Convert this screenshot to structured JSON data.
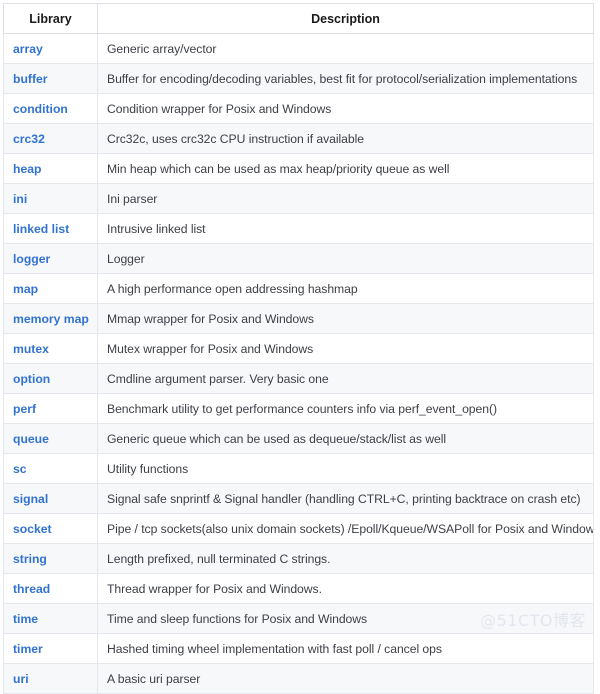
{
  "table": {
    "headers": {
      "library": "Library",
      "description": "Description"
    },
    "rows": [
      {
        "library": "array",
        "description": "Generic array/vector"
      },
      {
        "library": "buffer",
        "description": "Buffer for encoding/decoding variables, best fit for protocol/serialization implementations"
      },
      {
        "library": "condition",
        "description": "Condition wrapper for Posix and Windows"
      },
      {
        "library": "crc32",
        "description": "Crc32c, uses crc32c CPU instruction if available"
      },
      {
        "library": "heap",
        "description": "Min heap which can be used as max heap/priority queue as well"
      },
      {
        "library": "ini",
        "description": "Ini parser"
      },
      {
        "library": "linked list",
        "description": "Intrusive linked list"
      },
      {
        "library": "logger",
        "description": "Logger"
      },
      {
        "library": "map",
        "description": "A high performance open addressing hashmap"
      },
      {
        "library": "memory map",
        "description": "Mmap wrapper for Posix and Windows"
      },
      {
        "library": "mutex",
        "description": "Mutex wrapper for Posix and Windows"
      },
      {
        "library": "option",
        "description": "Cmdline argument parser. Very basic one"
      },
      {
        "library": "perf",
        "description": "Benchmark utility to get performance counters info via perf_event_open()"
      },
      {
        "library": "queue",
        "description": "Generic queue which can be used as dequeue/stack/list as well"
      },
      {
        "library": "sc",
        "description": "Utility functions"
      },
      {
        "library": "signal",
        "description": "Signal safe snprintf & Signal handler (handling CTRL+C, printing backtrace on crash etc)"
      },
      {
        "library": "socket",
        "description": "Pipe / tcp sockets(also unix domain sockets) /Epoll/Kqueue/WSAPoll for Posix and Windows"
      },
      {
        "library": "string",
        "description": "Length prefixed, null terminated C strings."
      },
      {
        "library": "thread",
        "description": "Thread wrapper for Posix and Windows."
      },
      {
        "library": "time",
        "description": "Time and sleep functions for Posix and Windows"
      },
      {
        "library": "timer",
        "description": "Hashed timing wheel implementation with fast poll / cancel ops"
      },
      {
        "library": "uri",
        "description": "A basic uri parser"
      }
    ]
  },
  "watermark": {
    "text": "@51CTO博客"
  },
  "colors": {
    "link": "#3273d0",
    "stripe": "#f7f8fa",
    "border": "#e4e7ed",
    "header_text": "#1a1a1a",
    "body_text": "#3c3f45",
    "watermark": "#e3e6ee"
  }
}
